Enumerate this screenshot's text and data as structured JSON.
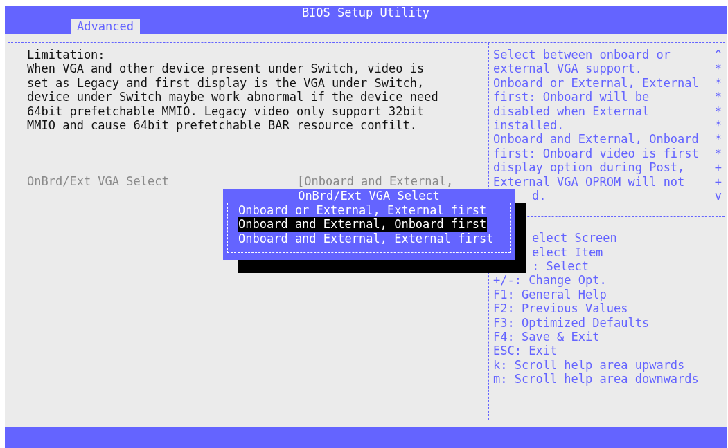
{
  "window": {
    "title": "BIOS Setup Utility"
  },
  "tabs": [
    {
      "label": "Advanced",
      "selected": true
    }
  ],
  "left": {
    "heading": "Limitation:",
    "description": "When VGA and other device present under Switch, video is\nset as Legacy and first display is the VGA under Switch,\ndevice under Switch maybe work abnormal if the device need\n64bit prefetchable MMIO. Legacy video only support 32bit\nMMIO and cause 64bit prefetchable BAR resource confilt.",
    "items": [
      {
        "label": "OnBrd/Ext VGA Select",
        "value": "[Onboard and External,",
        "disabled": true
      }
    ]
  },
  "help": [
    {
      "text": "Select between onboard or",
      "mark": "^",
      "kind": "line"
    },
    {
      "text": "external VGA support.",
      "mark": "*",
      "kind": "line"
    },
    {
      "text": "Onboard or External, External",
      "mark": "*",
      "kind": "line"
    },
    {
      "text": "first: Onboard will be",
      "mark": "*",
      "kind": "line"
    },
    {
      "text": "disabled when External",
      "mark": "*",
      "kind": "line"
    },
    {
      "text": "installed.",
      "mark": "*",
      "kind": "line"
    },
    {
      "text": "Onboard and External, Onboard",
      "mark": "*",
      "kind": "line"
    },
    {
      "text": "first: Onboard video is first",
      "mark": "*",
      "kind": "line"
    },
    {
      "text": "display option during Post,",
      "mark": "+",
      "kind": "line"
    },
    {
      "text": "External VGA OPROM will not",
      "mark": "+",
      "kind": "line"
    },
    {
      "text": "d.",
      "mark": "v",
      "kind": "covered"
    }
  ],
  "keys": [
    {
      "text": "elect Screen",
      "kind": "covered"
    },
    {
      "text": "elect Item",
      "kind": "covered"
    },
    {
      "text": ": Select",
      "kind": "covered"
    },
    {
      "text": "+/-: Change Opt.",
      "kind": "line"
    },
    {
      "text": "F1: General Help",
      "kind": "line"
    },
    {
      "text": "F2: Previous Values",
      "kind": "line"
    },
    {
      "text": "F3: Optimized Defaults",
      "kind": "line"
    },
    {
      "text": "F4: Save & Exit",
      "kind": "line"
    },
    {
      "text": "ESC: Exit",
      "kind": "line"
    },
    {
      "text": "k: Scroll help area upwards",
      "kind": "line"
    },
    {
      "text": "m: Scroll help area downwards",
      "kind": "line"
    }
  ],
  "popup": {
    "title": "OnBrd/Ext VGA Select",
    "options": [
      {
        "label": "Onboard or External, External first",
        "selected": false
      },
      {
        "label": "Onboard and External, Onboard first",
        "selected": true
      },
      {
        "label": "Onboard and External, External first",
        "selected": false
      }
    ]
  }
}
